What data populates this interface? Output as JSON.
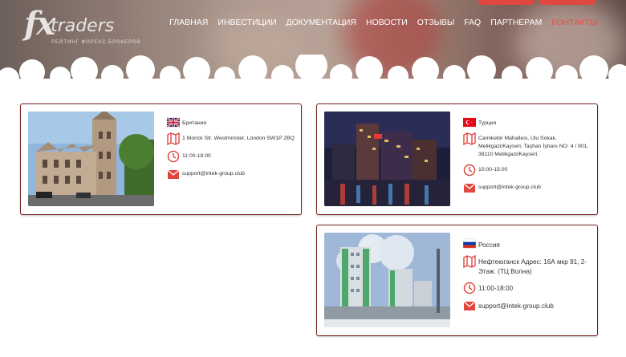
{
  "header": {
    "logo_fx": "fx",
    "logo_word": "traders",
    "logo_tagline": "РЕЙТИНГ ФОРЕКС БРОКЕРОВ",
    "nav": [
      {
        "label": "ГЛАВНАЯ",
        "active": false
      },
      {
        "label": "ИНВЕСТИЦИИ",
        "active": false
      },
      {
        "label": "ДОКУМЕНТАЦИЯ",
        "active": false
      },
      {
        "label": "НОВОСТИ",
        "active": false
      },
      {
        "label": "ОТЗЫВЫ",
        "active": false
      },
      {
        "label": "FAQ",
        "active": false
      },
      {
        "label": "ПАРТНЕРАМ",
        "active": false
      },
      {
        "label": "КОНТАКТЫ",
        "active": true
      }
    ]
  },
  "offices": [
    {
      "country": "Британия",
      "flag": "uk-flag",
      "address": "1 Monck Str. Westminster, London SW1P 2BQ",
      "hours": "11:00-18:00",
      "email": "support@intek-group.club"
    },
    {
      "country": "Турция",
      "flag": "turkey-flag",
      "address": "Camikebir Mahallesi, Ulu Sokak, Melikgazi/Kayseri, Taşhan İşhanı NO: 4 / 801, 38110 Melikgazi/Kayseri.",
      "hours": "10:00-15:00",
      "email": "support@intek-group.club"
    },
    {
      "country": "Россия",
      "flag": "russia-flag",
      "address": "Нефтеюганск Адрес: 16А мкр 91, 2-Этаж. (ТЦ Волна)",
      "hours": "11:00-18:00",
      "email": "support@intek-group.club"
    }
  ],
  "colors": {
    "accent": "#e84f45",
    "card_border": "#7a2222",
    "icon": "#e0473f"
  }
}
